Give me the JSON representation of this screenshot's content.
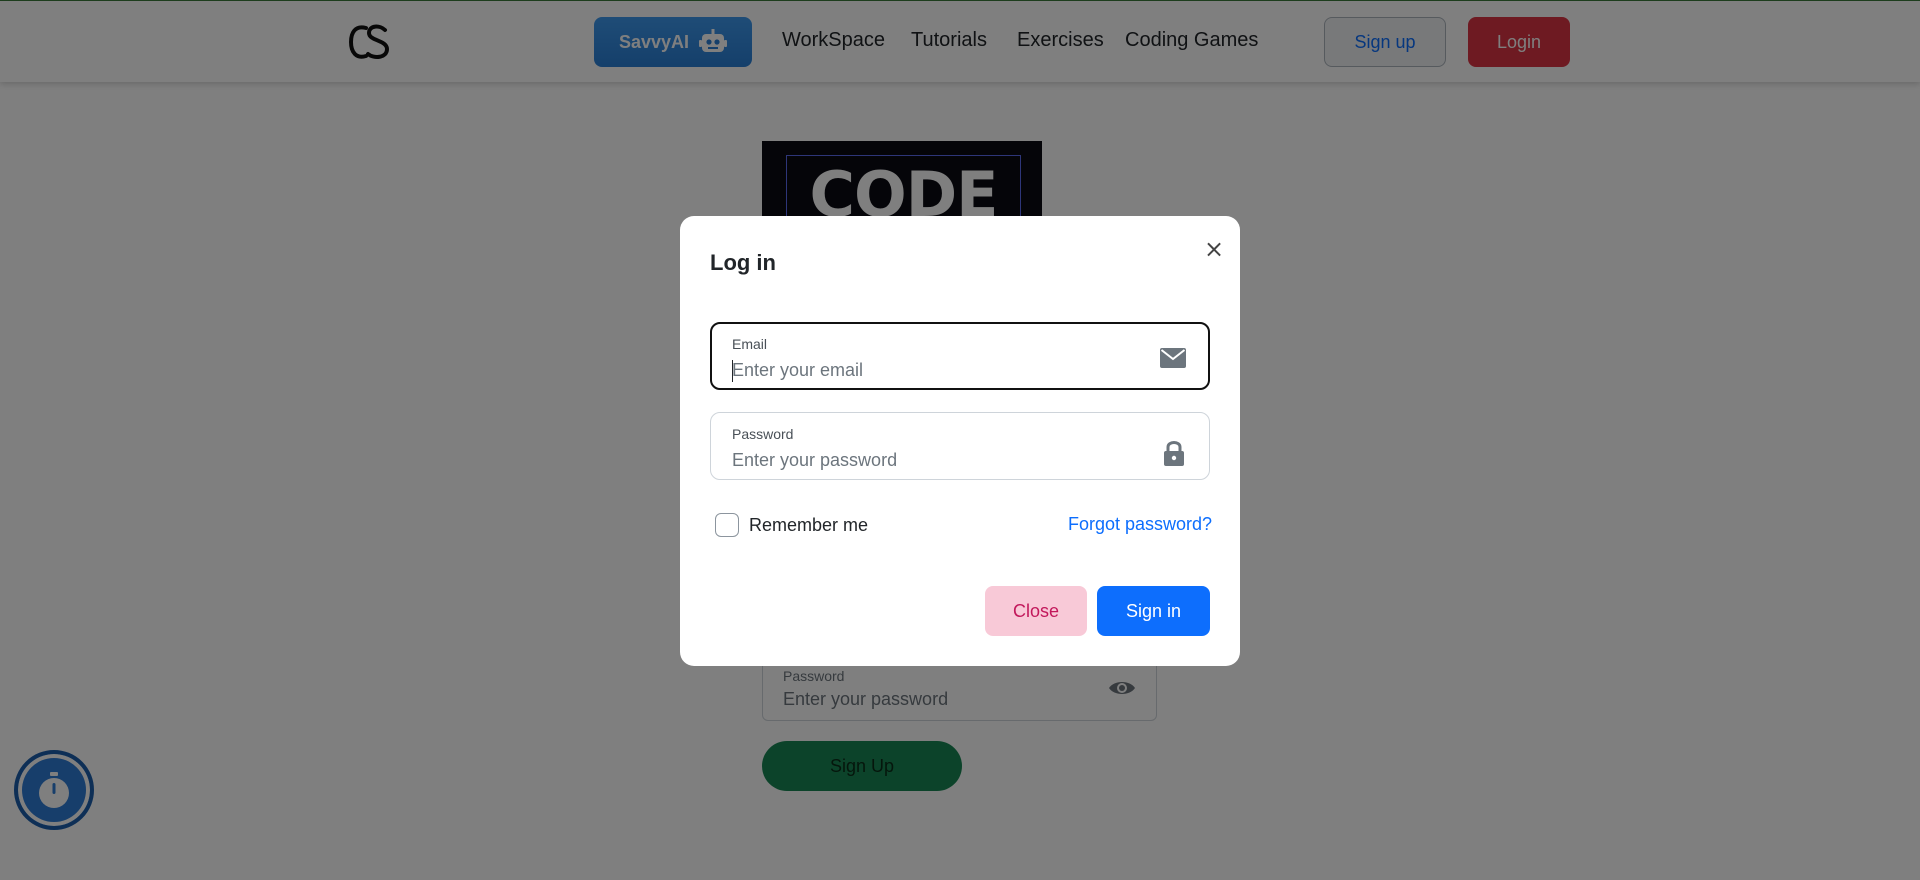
{
  "navbar": {
    "logo_text": "CS",
    "savvy_label": "SavvyAI",
    "links": [
      "WorkSpace",
      "Tutorials",
      "Exercises",
      "Coding Games"
    ],
    "signup_label": "Sign up",
    "login_label": "Login"
  },
  "background": {
    "banner_text": "CODE",
    "password_label": "Password",
    "password_placeholder": "Enter your password",
    "signup_button": "Sign Up"
  },
  "modal": {
    "title": "Log in",
    "email": {
      "label": "Email",
      "placeholder": "Enter your email",
      "value": ""
    },
    "password": {
      "label": "Password",
      "placeholder": "Enter your password",
      "value": ""
    },
    "remember_label": "Remember me",
    "remember_checked": false,
    "forgot_label": "Forgot password?",
    "close_label": "Close",
    "signin_label": "Sign in"
  },
  "icons": {
    "logo": "cs-logo",
    "savvy": "robot-icon",
    "modal_close": "close-icon",
    "email": "envelope-icon",
    "password": "lock-icon",
    "background_password": "eye-icon",
    "timer": "stopwatch-icon"
  },
  "colors": {
    "primary": "#0d6efd",
    "danger": "#dc3545",
    "savvy": "#2a7fd6",
    "close_bg": "#f8c9d7",
    "close_text": "#c2185b",
    "success": "#198754"
  }
}
